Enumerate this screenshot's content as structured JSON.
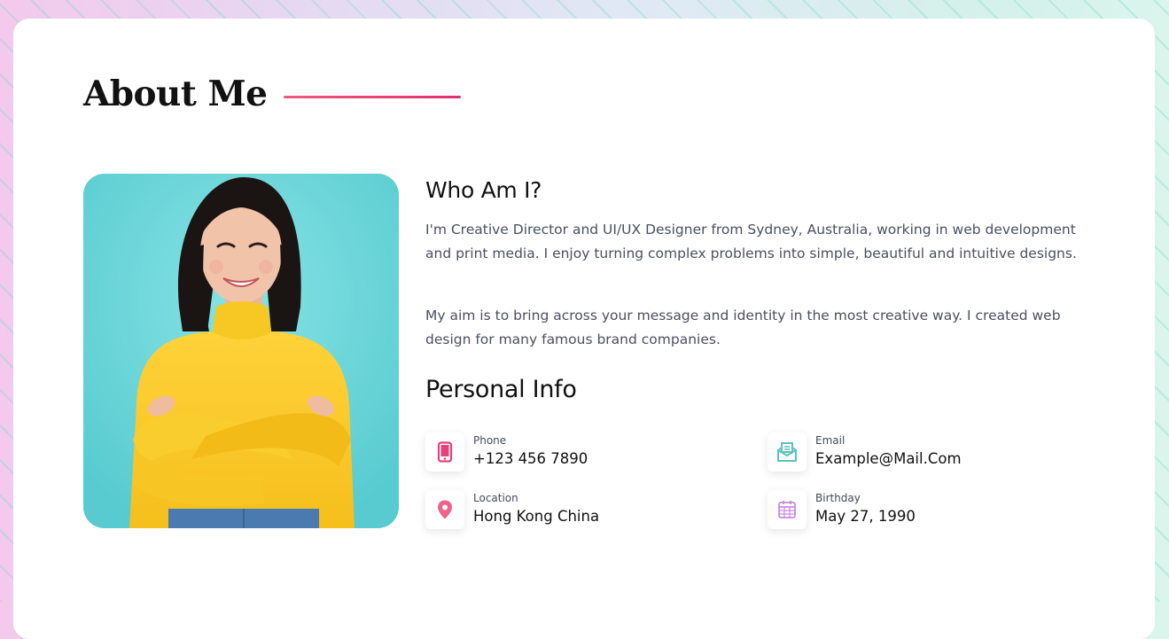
{
  "section": {
    "title": "About Me"
  },
  "photo": {
    "description": "portrait-photo"
  },
  "about": {
    "who_heading": "Who Am I?",
    "paragraph_1": "I'm Creative Director and UI/UX Designer from Sydney, Australia, working in web development and print media. I enjoy turning complex problems into simple, beautiful and intuitive designs.",
    "paragraph_2": "My aim is to bring across your message and identity in the most creative way. I created web design for many famous brand companies."
  },
  "personal_info": {
    "heading": "Personal Info",
    "items": [
      {
        "icon": "phone-icon",
        "label": "Phone",
        "value": "+123 456 7890",
        "color": "#e3427a"
      },
      {
        "icon": "envelope-icon",
        "label": "Email",
        "value": "Example@Mail.Com",
        "color": "#5cc3bd"
      },
      {
        "icon": "location-pin-icon",
        "label": "Location",
        "value": "Hong Kong China",
        "color": "#f06289"
      },
      {
        "icon": "calendar-icon",
        "label": "Birthday",
        "value": "May 27, 1990",
        "color": "#c98be0"
      }
    ]
  },
  "colors": {
    "accent": "#e0306e",
    "photo_bg": "#66d3d7"
  }
}
